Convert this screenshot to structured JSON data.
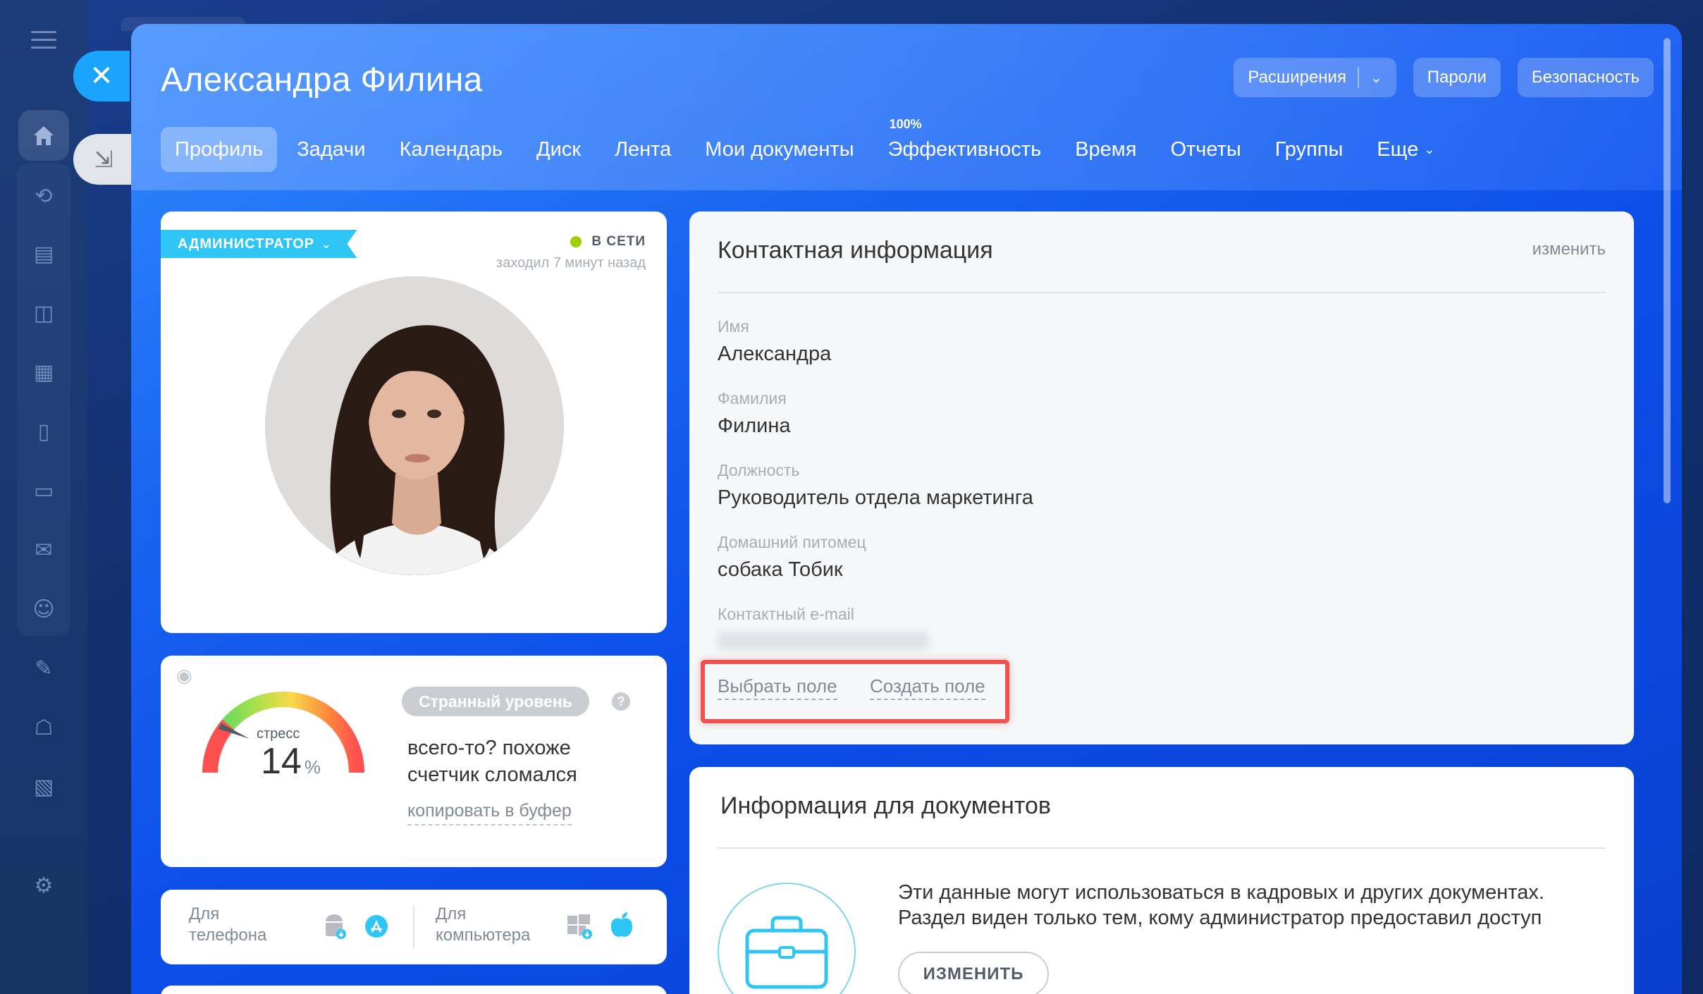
{
  "window": {
    "title": "Александра Филина"
  },
  "header": {
    "buttons": {
      "extensions": "Расширения",
      "passwords": "Пароли",
      "security": "Безопасность"
    }
  },
  "tabs": [
    {
      "label": "Профиль",
      "active": true
    },
    {
      "label": "Задачи"
    },
    {
      "label": "Календарь"
    },
    {
      "label": "Диск"
    },
    {
      "label": "Лента"
    },
    {
      "label": "Мои документы"
    },
    {
      "label": "Эффективность",
      "badge": "100%"
    },
    {
      "label": "Время"
    },
    {
      "label": "Отчеты"
    },
    {
      "label": "Группы"
    },
    {
      "label": "Еще"
    }
  ],
  "profile": {
    "role_badge": "АДМИНИСТРАТОР",
    "status": "В СЕТИ",
    "status_color": "#9dcf00",
    "last_seen": "заходил 7 минут назад"
  },
  "stress": {
    "label": "стресс",
    "value": "14",
    "unit": "%",
    "level_pill": "Странный уровень",
    "help": "?",
    "description": "всего-то? похоже счетчик сломался",
    "copy_link": "копировать в буфер"
  },
  "apps": {
    "phone_label": "Для телефона",
    "computer_label": "Для компьютера",
    "icons": [
      "android-icon",
      "app-store-icon",
      "windows-icon",
      "apple-icon"
    ]
  },
  "contact": {
    "title": "Контактная информация",
    "edit": "изменить",
    "fields": [
      {
        "label": "Имя",
        "value": "Александра"
      },
      {
        "label": "Фамилия",
        "value": "Филина"
      },
      {
        "label": "Должность",
        "value": "Руководитель отдела маркетинга"
      },
      {
        "label": "Домашний питомец",
        "value": "собака Тобик"
      },
      {
        "label": "Контактный e-mail",
        "value": ""
      }
    ],
    "select_field": "Выбрать поле",
    "create_field": "Создать поле"
  },
  "documents": {
    "title": "Информация для документов",
    "text_line1": "Эти данные могут использоваться в кадровых и других документах.",
    "text_line2": "Раздел виден только тем, кому администратор предоставил доступ",
    "button": "ИЗМЕНИТЬ"
  },
  "colors": {
    "accent_blue": "#2fc6f6",
    "close_button": "#1aa3ff",
    "highlight_red": "#ef5350"
  }
}
